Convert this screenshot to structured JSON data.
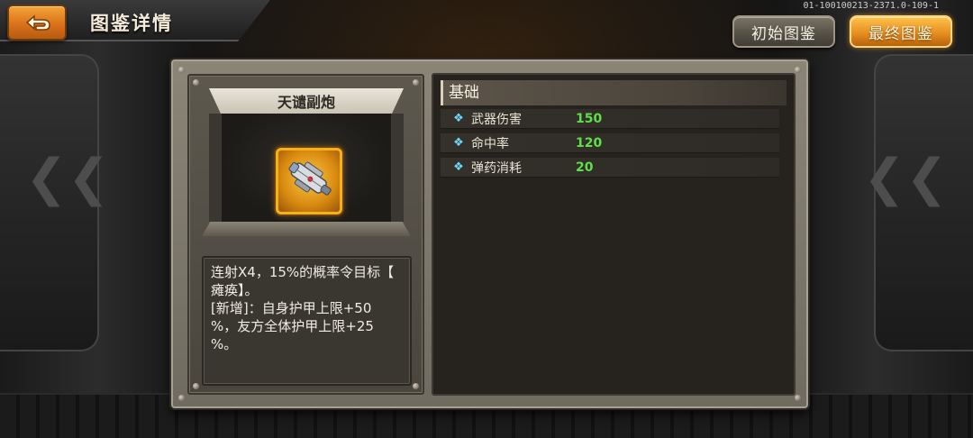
{
  "header": {
    "title": "图鉴详情",
    "version": "01-100100213-2371.0-109-1",
    "back_icon": "return-arrow-icon"
  },
  "buttons": {
    "initial": "初始图鉴",
    "final": "最终图鉴"
  },
  "item": {
    "name": "天谴副炮",
    "icon": "cannon-weapon-icon",
    "description": "连射X4，15%的概率令目标【\n瘫痪】。\n[新增]：自身护甲上限+50\n%，友方全体护甲上限+25\n%。"
  },
  "stats": {
    "section_title": "基础",
    "rows": [
      {
        "label": "武器伤害",
        "value": "150"
      },
      {
        "label": "命中率",
        "value": "120"
      },
      {
        "label": "弹药消耗",
        "value": "20"
      }
    ]
  },
  "colors": {
    "accent_orange": "#e69020",
    "stat_value_green": "#5fe04a",
    "stat_icon_cyan": "#6ed8ff"
  }
}
